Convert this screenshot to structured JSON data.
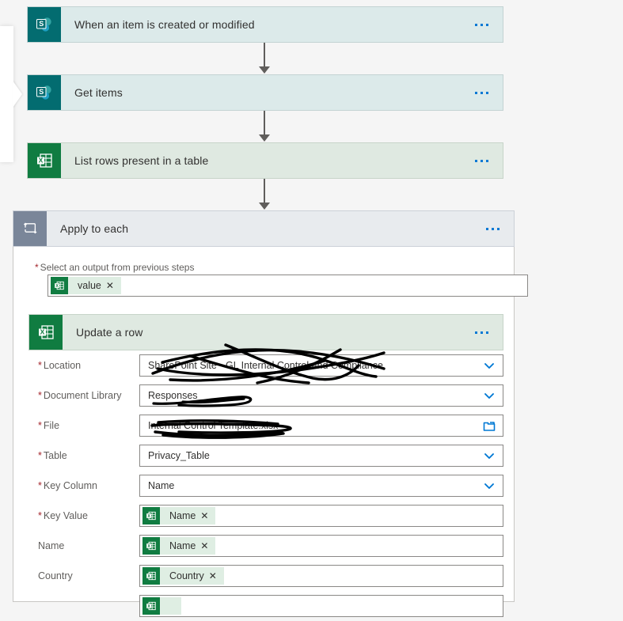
{
  "app": {
    "name": "Power Automate flow designer",
    "accent_color": "#0078d4",
    "sharepoint_color": "#036c70",
    "excel_color": "#107c41",
    "loop_color": "#7a8699",
    "required_star_color": "#a4262c"
  },
  "left_panel": {
    "name": "collapsed-side-panel",
    "expander_label": ""
  },
  "flow": {
    "steps": [
      {
        "id": "trigger",
        "title": "When an item is created or modified",
        "connector": "sharepoint",
        "icon": "sharepoint-icon",
        "menu_label": "…"
      },
      {
        "id": "get-items",
        "title": "Get items",
        "connector": "sharepoint",
        "icon": "sharepoint-icon",
        "menu_label": "…"
      },
      {
        "id": "list-rows",
        "title": "List rows present in a table",
        "connector": "excel",
        "icon": "excel-icon",
        "menu_label": "…"
      }
    ]
  },
  "loop": {
    "title": "Apply to each",
    "icon": "loop-icon",
    "menu_label": "…",
    "output_field": {
      "label": "Select an output from previous steps",
      "required": true,
      "token": {
        "label": "value",
        "icon": "excel-icon",
        "remove_label": "✕"
      }
    },
    "nested_action": {
      "title": "Update a row",
      "icon": "excel-icon",
      "menu_label": "…"
    },
    "fields": [
      {
        "label": "Location",
        "required": true,
        "type": "dropdown",
        "value": "SharePoint Site - GL Internal Control and Compliance",
        "redacted": true,
        "trailing_icon": "chevron-down-icon"
      },
      {
        "label": "Document Library",
        "required": true,
        "type": "dropdown",
        "value": "Responses",
        "redacted": true,
        "trailing_icon": "chevron-down-icon"
      },
      {
        "label": "File",
        "required": true,
        "type": "filepicker",
        "value": "Internal Control Template.xlsx",
        "redacted": true,
        "trailing_icon": "folder-icon"
      },
      {
        "label": "Table",
        "required": true,
        "type": "dropdown",
        "value": "Privacy_Table",
        "redacted": false,
        "trailing_icon": "chevron-down-icon"
      },
      {
        "label": "Key Column",
        "required": true,
        "type": "dropdown",
        "value": "Name",
        "redacted": false,
        "trailing_icon": "chevron-down-icon"
      },
      {
        "label": "Key Value",
        "required": true,
        "type": "token",
        "token": {
          "label": "Name",
          "icon": "excel-icon",
          "remove_label": "✕"
        }
      },
      {
        "label": "Name",
        "required": false,
        "type": "token",
        "token": {
          "label": "Name",
          "icon": "excel-icon",
          "remove_label": "✕"
        }
      },
      {
        "label": "Country",
        "required": false,
        "type": "token",
        "token": {
          "label": "Country",
          "icon": "excel-icon",
          "remove_label": "✕"
        }
      },
      {
        "label": "",
        "required": false,
        "type": "token",
        "clipped": true,
        "token": {
          "label": "",
          "icon": "excel-icon",
          "remove_label": ""
        }
      }
    ]
  }
}
